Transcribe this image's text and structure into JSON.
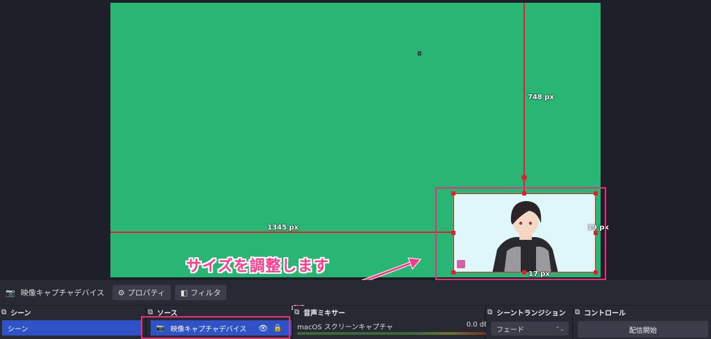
{
  "preview": {
    "guide_top_label": "748 px",
    "guide_left_label": "1345 px",
    "guide_right_label": "19 px",
    "guide_bottom_label": "17 px"
  },
  "annotation": {
    "callout_text": "サイズを調整します",
    "color": "#ff3a8c"
  },
  "source_toolbar": {
    "source_name": "映像キャプチャデバイス",
    "properties_label": "プロパティ",
    "filters_label": "フィルタ"
  },
  "docks": {
    "scenes": {
      "title": "シーン",
      "items": [
        "シーン"
      ]
    },
    "sources": {
      "title": "ソース",
      "items": [
        {
          "label": "映像キャプチャデバイス"
        }
      ]
    },
    "mixer": {
      "title": "音声ミキサー",
      "channel": "macOS スクリーンキャプチャ",
      "level": "0.0 dB"
    },
    "transitions": {
      "title": "シーントランジション",
      "selected": "フェード"
    },
    "controls": {
      "title": "コントロール",
      "start_label": "配信開始"
    }
  },
  "colors": {
    "canvas_bg": "#29b573",
    "guide_red": "#e0202a",
    "highlight_pink": "#e8317a",
    "selected_blue": "#2f53c6"
  }
}
